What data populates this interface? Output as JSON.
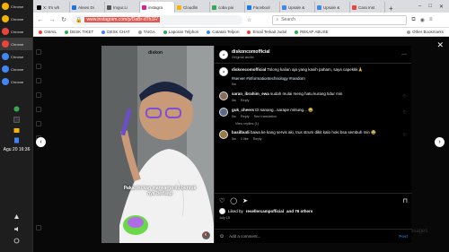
{
  "taskbar": {
    "items": [
      {
        "label": "Chrome",
        "color": "#f4b400"
      },
      {
        "label": "Chrome",
        "color": "#f4b400"
      },
      {
        "label": "Chrome",
        "color": "#e8453c"
      },
      {
        "label": "Chrome",
        "color": "#e8453c"
      },
      {
        "label": "Chrome",
        "color": "#4285f4"
      },
      {
        "label": "Chrome",
        "color": "#4285f4"
      },
      {
        "label": "Chrome",
        "color": "#4285f4"
      }
    ],
    "clock": "Agu 20 16:36"
  },
  "browser": {
    "tabs": [
      {
        "label": "X: It's wh",
        "color": "#000000"
      },
      {
        "label": "Akses Di",
        "color": "#1a73e8"
      },
      {
        "label": "Imgur.Li",
        "color": "#555555"
      },
      {
        "label": "instagra",
        "color": "#d6249f"
      },
      {
        "label": "Cloudlin",
        "color": "#f4b400"
      },
      {
        "label": "coba pai",
        "color": "#34a853"
      },
      {
        "label": "Facebool",
        "color": "#1877f2"
      },
      {
        "label": "Upsale &",
        "color": "#4285f4"
      },
      {
        "label": "Upsale &",
        "color": "#4285f4"
      },
      {
        "label": "Cara Inst",
        "color": "#e8453c"
      }
    ],
    "url": "www.instagram.com/p/DaBr-dTh1F/",
    "search_placeholder": "Search",
    "bookmarks": [
      {
        "label": "GMAIL",
        "color": "#ea4335"
      },
      {
        "label": "DESK TIKET",
        "color": "#34a853"
      },
      {
        "label": "DESK CHAT",
        "color": "#4285f4"
      },
      {
        "label": "TAIGA",
        "color": "#9aa0a6"
      },
      {
        "label": "Laporan Telphon",
        "color": "#34a853"
      },
      {
        "label": "Catatan Telpon",
        "color": "#4285f4"
      },
      {
        "label": "Email Terkait Judol",
        "color": "#ea4335"
      },
      {
        "label": "REKAP ABUSE",
        "color": "#34a853"
      }
    ],
    "other_bookmarks": "Other Bookmarks"
  },
  "post": {
    "username": "diskoncomofficial",
    "audio": "Original audio",
    "caption": "Tolong kalian aja yang kasih paham, saya capekkk🙏",
    "hashtags": "#server #informationtechnology #random",
    "caption_age": "5w",
    "video_caption": "Pakai ini kan marwarna itu bentuk nya berlsap",
    "watermark": "diskon",
    "comments": [
      {
        "user": "saran_ibrahim_ewa",
        "text": "sudah mulai meng hatu kurang tidur min",
        "age": "5w",
        "likes": "",
        "reply": "Reply"
      },
      {
        "user": "guk_cheers",
        "text": "Di sanang...sarape minung... 😂",
        "age": "5w",
        "likes": "",
        "reply": "Reply",
        "translate": "See translation"
      },
      {
        "user": "basilbudi",
        "text": "bawa ke kang servis aki, trus strum dikit kalo hoki bsa sembuh min 😂",
        "age": "5w",
        "likes": "1 like",
        "reply": "Reply"
      }
    ],
    "view_replies": "View replies (1)",
    "liked_by": "Liked by",
    "liked_user": "resellercampofficial",
    "liked_rest": "and 76 others",
    "date": "July 15",
    "add_comment": "Add a comment...",
    "post_button": "Post",
    "bg_text": "esages"
  },
  "colors": {
    "accent_red": "#e5554f",
    "instagram_blue": "#1d6fb8"
  }
}
